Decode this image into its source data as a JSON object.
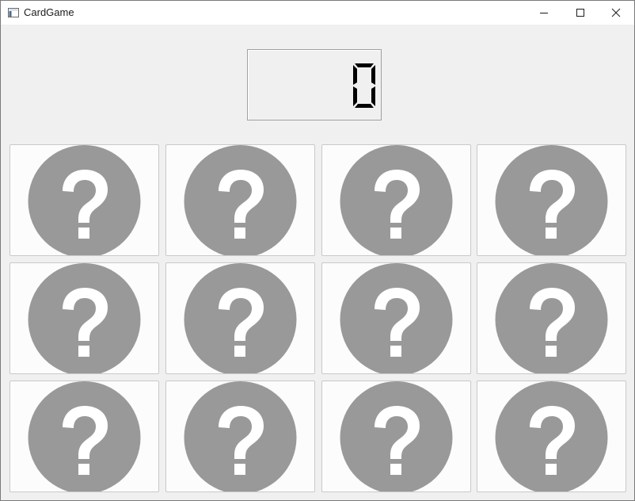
{
  "window": {
    "title": "CardGame"
  },
  "score": {
    "value": "0"
  },
  "cards": [
    {
      "state": "face-down",
      "symbol": "?"
    },
    {
      "state": "face-down",
      "symbol": "?"
    },
    {
      "state": "face-down",
      "symbol": "?"
    },
    {
      "state": "face-down",
      "symbol": "?"
    },
    {
      "state": "face-down",
      "symbol": "?"
    },
    {
      "state": "face-down",
      "symbol": "?"
    },
    {
      "state": "face-down",
      "symbol": "?"
    },
    {
      "state": "face-down",
      "symbol": "?"
    },
    {
      "state": "face-down",
      "symbol": "?"
    },
    {
      "state": "face-down",
      "symbol": "?"
    },
    {
      "state": "face-down",
      "symbol": "?"
    },
    {
      "state": "face-down",
      "symbol": "?"
    }
  ],
  "colors": {
    "card_back_circle": "#999999",
    "card_back_mark": "#ffffff",
    "lcd_digit": "#000000"
  },
  "icons": {
    "app": "window-app-icon",
    "minimize": "minimize-icon",
    "maximize": "maximize-icon",
    "close": "close-icon",
    "card_back": "question-mark-icon"
  }
}
